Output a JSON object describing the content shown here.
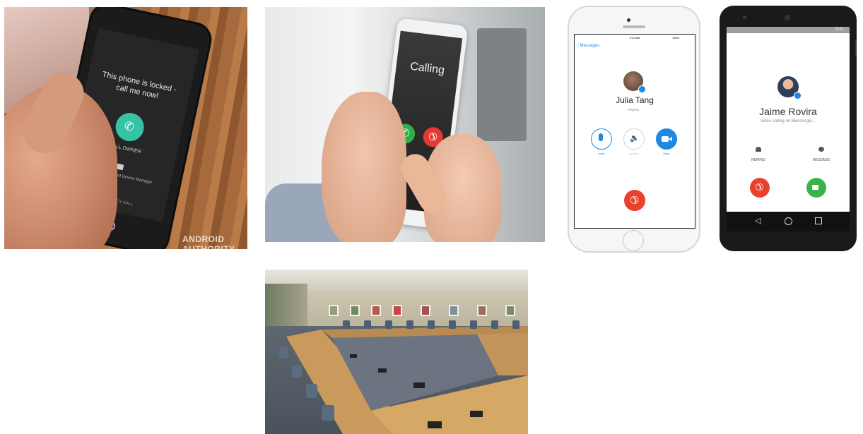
{
  "photo1": {
    "notice": "This phone is locked - call me now!",
    "call_owner": "CALL OWNER",
    "locked_by": "Locked by Android Device Manager",
    "emergency": "EMERGENCY CALL",
    "watermark": "ANDROID AUTHORITY"
  },
  "photo2": {
    "calling_label": "Calling"
  },
  "iphone": {
    "back_label": "Messages",
    "time": "9:41 AM",
    "battery": "100%",
    "contact_name": "Julia Tang",
    "status": "ringing...",
    "buttons": [
      "mute",
      "speaker",
      "video"
    ]
  },
  "android": {
    "time": "9:41",
    "contact_name": "Jaime Rovira",
    "status": "Video calling on Messenger...",
    "remind_label": "REMIND",
    "message_label": "MESSAGE"
  },
  "colors": {
    "end_call_red": "#e8412c",
    "answer_green": "#3cb34a",
    "messenger_blue": "#1e88e5",
    "teal_accent": "#35c2a5"
  }
}
